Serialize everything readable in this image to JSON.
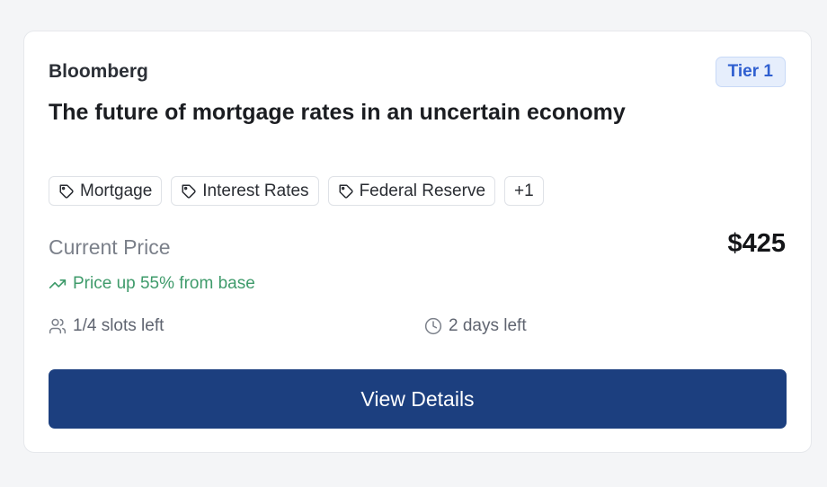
{
  "card": {
    "source": "Bloomberg",
    "tier": "Tier 1",
    "title": "The future of mortgage rates in an uncertain economy",
    "tags": [
      "Mortgage",
      "Interest Rates",
      "Federal Reserve"
    ],
    "more_tags": "+1",
    "price_label": "Current Price",
    "price_value": "$425",
    "trend_text": "Price up 55% from base",
    "slots_text": "1/4 slots left",
    "time_text": "2 days left",
    "button_label": "View Details"
  },
  "icons": {
    "tag": "tag-icon",
    "trend": "trending-up-icon",
    "users": "users-icon",
    "clock": "clock-icon"
  },
  "colors": {
    "accent": "#1c3f7f",
    "tier_text": "#2f5fd0",
    "tier_bg": "#e6eefc",
    "trend": "#3f9b6b",
    "muted": "#7b808a"
  }
}
